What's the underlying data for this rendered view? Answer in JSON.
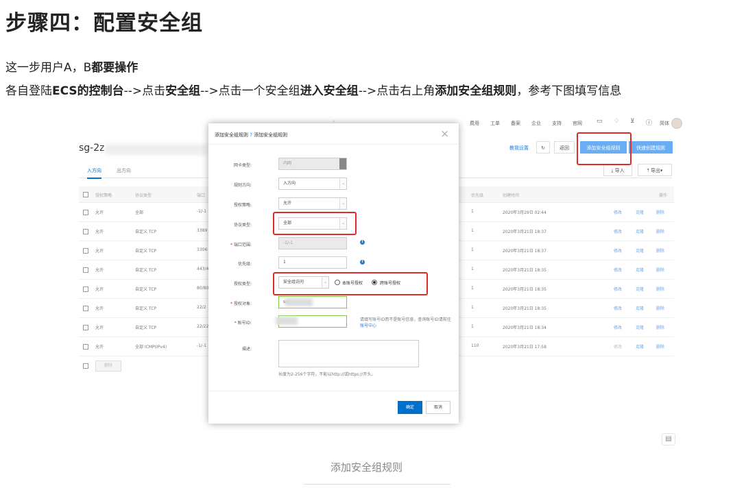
{
  "article": {
    "heading": "步骤四：配置安全组",
    "para1_pre": "这一步用户A，B",
    "para1_bold": "都要操作",
    "para2": {
      "t1": "各自登陆",
      "b1": "ECS的控制台",
      "t2": "-->点击",
      "b2": "安全组",
      "t3": "-->点击一个安全组",
      "b3": "进入安全组",
      "t4": "-->点击右上角",
      "b4": "添加安全组规则",
      "t5": "，参考下图填写信息"
    },
    "caption": "添加安全组规则"
  },
  "screenshot": {
    "topnav": {
      "items": [
        "费用",
        "工单",
        "备案",
        "企业",
        "支持",
        "官网",
        "简体"
      ]
    },
    "page_title": "sg-2z",
    "tabs": [
      "入方向",
      "出方向"
    ],
    "toolbar": {
      "teach_label": "教我设置",
      "back_label": "返回",
      "add_rule_label": "添加安全组规则",
      "quick_create_label": "快速创建规则",
      "import_label": "导入",
      "export_label": "导出"
    },
    "table": {
      "headers": [
        "授权策略",
        "协议类型",
        "端口",
        "优先级",
        "创建时间",
        "操作"
      ],
      "rows": [
        {
          "policy": "允许",
          "protocol": "全部",
          "port": "-1/-1",
          "priority": "1",
          "created": "2020年3月29日 02:44"
        },
        {
          "policy": "允许",
          "protocol": "自定义 TCP",
          "port": "3389",
          "priority": "1",
          "created": "2020年3月21日 18:37"
        },
        {
          "policy": "允许",
          "protocol": "自定义 TCP",
          "port": "3306",
          "priority": "1",
          "created": "2020年3月21日 18:37"
        },
        {
          "policy": "允许",
          "protocol": "自定义 TCP",
          "port": "443/4",
          "priority": "1",
          "created": "2020年3月21日 18:35"
        },
        {
          "policy": "允许",
          "protocol": "自定义 TCP",
          "port": "80/80",
          "priority": "1",
          "created": "2020年3月21日 18:35"
        },
        {
          "policy": "允许",
          "protocol": "自定义 TCP",
          "port": "22/2",
          "priority": "1",
          "created": "2020年3月21日 18:35"
        },
        {
          "policy": "允许",
          "protocol": "自定义 TCP",
          "port": "22/22",
          "priority": "1",
          "created": "2020年3月21日 18:34"
        },
        {
          "policy": "允许",
          "protocol": "全部 ICMP(IPv4)",
          "port": "-1/-1",
          "priority": "110",
          "created": "2020年3月21日 17:58"
        }
      ],
      "row_actions": [
        "修改",
        "克隆",
        "删除"
      ],
      "delete_label": "删除"
    },
    "dialog": {
      "title": "添加安全组规则",
      "help_link": "添加安全组规则",
      "close": "×",
      "nic_type_label": "网卡类型:",
      "nic_type_value": "内网",
      "direction_label": "规则方向:",
      "direction_value": "入方向",
      "policy_label": "授权策略:",
      "policy_value": "允许",
      "protocol_label": "协议类型:",
      "protocol_value": "全部",
      "port_label": "端口范围:",
      "port_value": "-1/-1",
      "priority_label": "优先级:",
      "priority_value": "1",
      "auth_type_label": "授权类型:",
      "auth_type_value": "安全组访问",
      "radio_own": "本账号授权",
      "radio_cross": "跨账号授权",
      "auth_object_label": "授权对象:",
      "auth_object_value": "sg-",
      "account_id_label": "账号ID:",
      "account_hint": "请填写账号ID而不是账号信息，查询账号ID请前往",
      "account_hint_link": "账号中心",
      "desc_label": "描述:",
      "desc_hint": "长度为2-256个字符，不能以http://或https://开头。",
      "ok_label": "确定",
      "cancel_label": "取消"
    }
  }
}
